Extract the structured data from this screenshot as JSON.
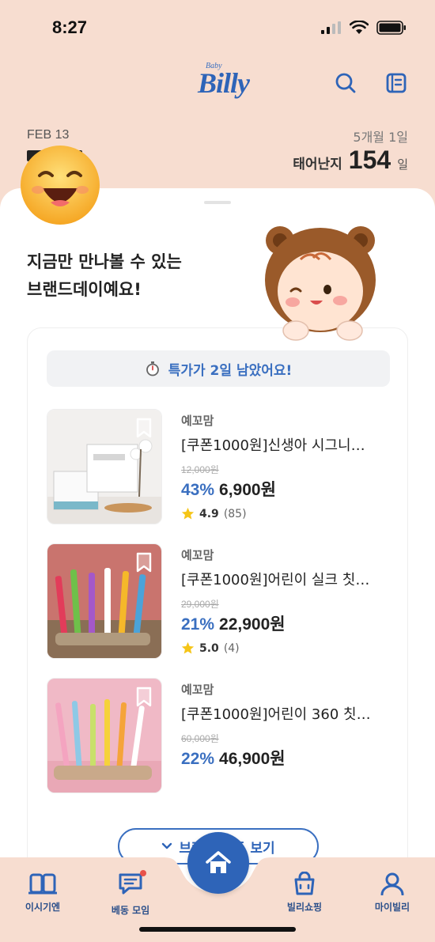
{
  "status_bar": {
    "time": "8:27"
  },
  "header": {
    "logo_small": "Baby",
    "logo_main": "Billy"
  },
  "date_info": {
    "date": "FEB 13",
    "age": "5개월 1일",
    "born_label": "태어난지",
    "born_days": "154",
    "born_unit": "일"
  },
  "sheet": {
    "headline_line1": "지금만 만나볼 수 있는",
    "headline_line2": "브랜드데이예요!",
    "timer_text": "특가가 2일 남았어요!",
    "products": [
      {
        "brand": "예꼬맘",
        "name": "[쿠폰1000원]신생아 시그니…",
        "original_price": "12,000원",
        "discount": "43%",
        "price": "6,900원",
        "rating": "4.9",
        "review_count": "(85)"
      },
      {
        "brand": "예꼬맘",
        "name": "[쿠폰1000원]어린이 실크 칫…",
        "original_price": "29,000원",
        "discount": "21%",
        "price": "22,900원",
        "rating": "5.0",
        "review_count": "(4)"
      },
      {
        "brand": "예꼬맘",
        "name": "[쿠폰1000원]어린이 360 칫…",
        "original_price": "60,000원",
        "discount": "22%",
        "price": "46,900원"
      }
    ],
    "view_all_label": "브랜드 모두 보기"
  },
  "tabbar": {
    "tabs": [
      {
        "label": "이시기엔",
        "icon": "book-icon"
      },
      {
        "label": "베동 모임",
        "icon": "chat-icon"
      },
      {
        "label": "빌리쇼핑",
        "icon": "shopping-bag-icon"
      },
      {
        "label": "마이빌리",
        "icon": "person-icon"
      }
    ],
    "home_icon": "home-icon"
  },
  "colors": {
    "accent": "#2e64b8",
    "background": "#f7ddd0",
    "rating_star": "#f5c518"
  }
}
